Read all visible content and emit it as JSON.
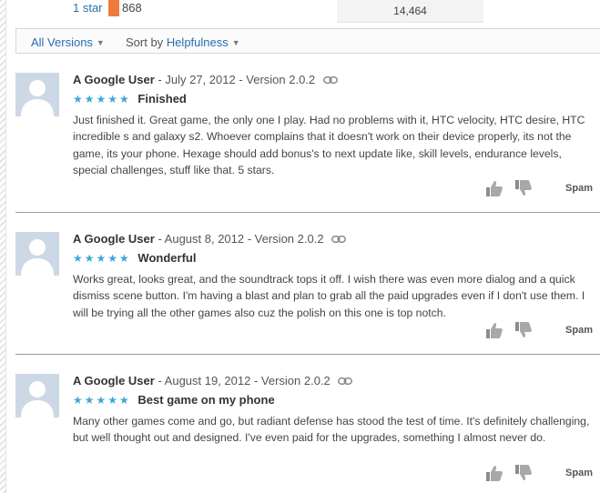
{
  "rating_summary": {
    "star_label": "1 star",
    "count": "868",
    "total": "14,464",
    "bar_color": "#ee7b3e"
  },
  "filters": {
    "versions_label": "All Versions",
    "sort_prefix": "Sort by",
    "sort_value": "Helpfulness"
  },
  "reviews": [
    {
      "author": "A Google User",
      "meta": " - July 27, 2012 - Version 2.0.2",
      "stars": "★★★★★",
      "title": "Finished",
      "text": "Just finished it. Great game, the only one I play. Had no problems with it, HTC velocity, HTC desire, HTC incredible s and galaxy s2. Whoever complains that it doesn't work on their device properly, its not the game, its your phone. Hexage should add bonus's to next update like, skill levels, endurance levels, special challenges, stuff like that. 5 stars.",
      "spam_label": "Spam"
    },
    {
      "author": "A Google User",
      "meta": " - August 8, 2012 - Version 2.0.2",
      "stars": "★★★★★",
      "title": "Wonderful",
      "text": "Works great, looks great, and the soundtrack tops it off. I wish there was even more dialog and a quick dismiss scene button. I'm having a blast and plan to grab all the paid upgrades even if I don't use them. I will be trying all the other games also cuz the polish on this one is top notch.",
      "spam_label": "Spam"
    },
    {
      "author": "A Google User",
      "meta": " - August 19, 2012 - Version 2.0.2",
      "stars": "★★★★★",
      "title": "Best game on my phone",
      "text": "Many other games come and go, but radiant defense has stood the test of time. It's definitely challenging, but well thought out and designed. I've even paid for the upgrades, something I almost never do.",
      "spam_label": "Spam"
    }
  ],
  "colors": {
    "link": "#2a6fb0",
    "star": "#3fa6d9",
    "avatar_bg": "#cdd8e6",
    "avatar_fg": "#ffffff"
  },
  "icons": [
    "link-icon",
    "thumbs-up-icon",
    "thumbs-down-icon",
    "avatar-silhouette-icon",
    "chevron-down-icon"
  ]
}
